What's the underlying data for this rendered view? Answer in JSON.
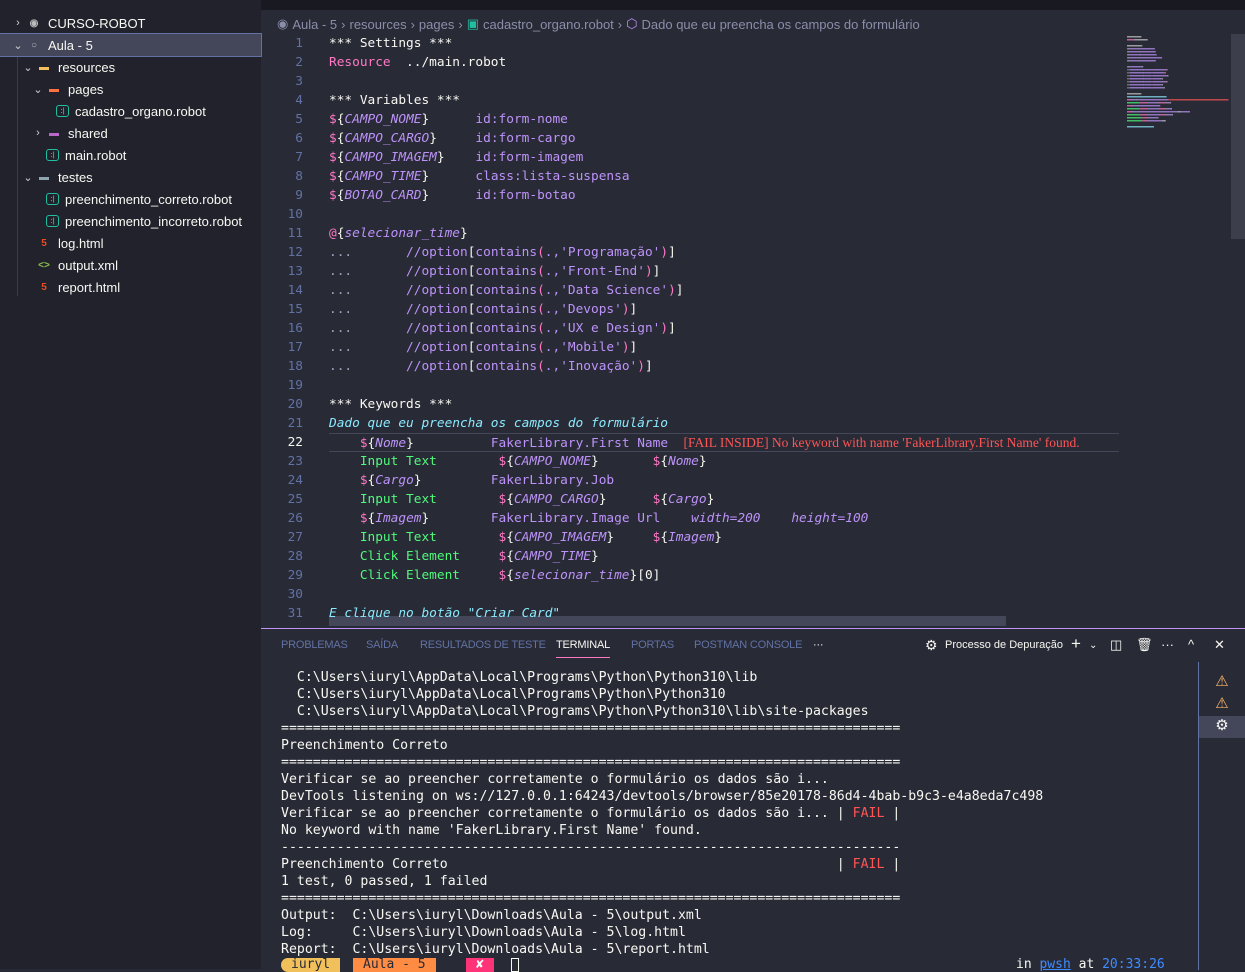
{
  "explorer": {
    "items": [
      {
        "label": "CURSO-ROBOT",
        "level": 0,
        "chev": "›",
        "icon": "circle-dot",
        "sel": false
      },
      {
        "label": "Aula - 5",
        "level": 0,
        "chev": "⌄",
        "icon": "circle",
        "sel": true
      },
      {
        "label": "resources",
        "level": 1,
        "chev": "⌄",
        "icon": "folder-resources",
        "sel": false
      },
      {
        "label": "pages",
        "level": 2,
        "chev": "⌄",
        "icon": "folder-pages",
        "sel": false
      },
      {
        "label": "cadastro_organo.robot",
        "level": 3,
        "chev": "",
        "icon": "robot",
        "sel": false
      },
      {
        "label": "shared",
        "level": 2,
        "chev": "›",
        "icon": "folder-shared",
        "sel": false
      },
      {
        "label": "main.robot",
        "level": 2,
        "chev": "",
        "icon": "robot",
        "sel": false
      },
      {
        "label": "testes",
        "level": 1,
        "chev": "⌄",
        "icon": "folder",
        "sel": false
      },
      {
        "label": "preenchimento_correto.robot",
        "level": 2,
        "chev": "",
        "icon": "robot",
        "sel": false
      },
      {
        "label": "preenchimento_incorreto.robot",
        "level": 2,
        "chev": "",
        "icon": "robot",
        "sel": false
      },
      {
        "label": "log.html",
        "level": 1,
        "chev": "",
        "icon": "html5",
        "sel": false
      },
      {
        "label": "output.xml",
        "level": 1,
        "chev": "",
        "icon": "xml",
        "sel": false
      },
      {
        "label": "report.html",
        "level": 1,
        "chev": "",
        "icon": "html5",
        "sel": false
      }
    ]
  },
  "breadcrumb": [
    "Aula - 5",
    "resources",
    "pages",
    "cadastro_organo.robot",
    "Dado que eu preencha os campos do formulário"
  ],
  "editor": {
    "current_line": 22,
    "lines": [
      [
        [
          "*** Settings ***",
          "k"
        ]
      ],
      [
        [
          "Resource",
          "p"
        ],
        [
          "  ../main.robot",
          "w"
        ]
      ],
      [],
      [
        [
          "*** Variables ***",
          "k"
        ]
      ],
      [
        [
          "$",
          "p"
        ],
        [
          "{",
          "w"
        ],
        [
          "CAMPO_NOME",
          "v"
        ],
        [
          "}",
          "w"
        ],
        [
          "      id:form-nome",
          "t"
        ]
      ],
      [
        [
          "$",
          "p"
        ],
        [
          "{",
          "w"
        ],
        [
          "CAMPO_CARGO",
          "v"
        ],
        [
          "}",
          "w"
        ],
        [
          "     id:form-cargo",
          "t"
        ]
      ],
      [
        [
          "$",
          "p"
        ],
        [
          "{",
          "w"
        ],
        [
          "CAMPO_IMAGEM",
          "v"
        ],
        [
          "}",
          "w"
        ],
        [
          "    id:form-imagem",
          "t"
        ]
      ],
      [
        [
          "$",
          "p"
        ],
        [
          "{",
          "w"
        ],
        [
          "CAMPO_TIME",
          "v"
        ],
        [
          "}",
          "w"
        ],
        [
          "      class:lista-suspensa",
          "t"
        ]
      ],
      [
        [
          "$",
          "p"
        ],
        [
          "{",
          "w"
        ],
        [
          "BOTAO_CARD",
          "v"
        ],
        [
          "}",
          "w"
        ],
        [
          "      id:form-botao",
          "t"
        ]
      ],
      [],
      [
        [
          "@",
          "p"
        ],
        [
          "{",
          "w"
        ],
        [
          "selecionar_time",
          "v"
        ],
        [
          "}",
          "w"
        ]
      ],
      [
        [
          "...",
          "d"
        ],
        [
          "       //option",
          "t"
        ],
        [
          "[",
          "w"
        ],
        [
          "contains",
          "t"
        ],
        [
          "(",
          "p"
        ],
        [
          ".,'Programação'",
          "t"
        ],
        [
          ")",
          "p"
        ],
        [
          "]",
          "w"
        ]
      ],
      [
        [
          "...",
          "d"
        ],
        [
          "       //option",
          "t"
        ],
        [
          "[",
          "w"
        ],
        [
          "contains",
          "t"
        ],
        [
          "(",
          "p"
        ],
        [
          ".,'Front-End'",
          "t"
        ],
        [
          ")",
          "p"
        ],
        [
          "]",
          "w"
        ]
      ],
      [
        [
          "...",
          "d"
        ],
        [
          "       //option",
          "t"
        ],
        [
          "[",
          "w"
        ],
        [
          "contains",
          "t"
        ],
        [
          "(",
          "p"
        ],
        [
          ".,'Data Science'",
          "t"
        ],
        [
          ")",
          "p"
        ],
        [
          "]",
          "w"
        ]
      ],
      [
        [
          "...",
          "d"
        ],
        [
          "       //option",
          "t"
        ],
        [
          "[",
          "w"
        ],
        [
          "contains",
          "t"
        ],
        [
          "(",
          "p"
        ],
        [
          ".,'Devops'",
          "t"
        ],
        [
          ")",
          "p"
        ],
        [
          "]",
          "w"
        ]
      ],
      [
        [
          "...",
          "d"
        ],
        [
          "       //option",
          "t"
        ],
        [
          "[",
          "w"
        ],
        [
          "contains",
          "t"
        ],
        [
          "(",
          "p"
        ],
        [
          ".,'UX e Design'",
          "t"
        ],
        [
          ")",
          "p"
        ],
        [
          "]",
          "w"
        ]
      ],
      [
        [
          "...",
          "d"
        ],
        [
          "       //option",
          "t"
        ],
        [
          "[",
          "w"
        ],
        [
          "contains",
          "t"
        ],
        [
          "(",
          "p"
        ],
        [
          ".,'Mobile'",
          "t"
        ],
        [
          ")",
          "p"
        ],
        [
          "]",
          "w"
        ]
      ],
      [
        [
          "...",
          "d"
        ],
        [
          "       //option",
          "t"
        ],
        [
          "[",
          "w"
        ],
        [
          "contains",
          "t"
        ],
        [
          "(",
          "p"
        ],
        [
          ".,'Inovação'",
          "t"
        ],
        [
          ")",
          "p"
        ],
        [
          "]",
          "w"
        ]
      ],
      [],
      [
        [
          "*** Keywords ***",
          "k"
        ]
      ],
      [
        [
          "Dado que eu preencha os campos do formulário",
          "c"
        ]
      ],
      [
        [
          "    $",
          "p"
        ],
        [
          "{",
          "w"
        ],
        [
          "Nome",
          "v"
        ],
        [
          "}",
          "w"
        ],
        [
          "          FakerLibrary.First Name  ",
          "t"
        ],
        [
          "[FAIL INSIDE] No keyword with name 'FakerLibrary.First Name' found.",
          "e"
        ]
      ],
      [
        [
          "    Input Text",
          "g"
        ],
        [
          "        $",
          "p"
        ],
        [
          "{",
          "w"
        ],
        [
          "CAMPO_NOME",
          "v"
        ],
        [
          "}",
          "w"
        ],
        [
          "       $",
          "p"
        ],
        [
          "{",
          "w"
        ],
        [
          "Nome",
          "v"
        ],
        [
          "}",
          "w"
        ]
      ],
      [
        [
          "    $",
          "p"
        ],
        [
          "{",
          "w"
        ],
        [
          "Cargo",
          "v"
        ],
        [
          "}",
          "w"
        ],
        [
          "         FakerLibrary.Job",
          "t"
        ]
      ],
      [
        [
          "    Input Text",
          "g"
        ],
        [
          "        $",
          "p"
        ],
        [
          "{",
          "w"
        ],
        [
          "CAMPO_CARGO",
          "v"
        ],
        [
          "}",
          "w"
        ],
        [
          "      $",
          "p"
        ],
        [
          "{",
          "w"
        ],
        [
          "Cargo",
          "v"
        ],
        [
          "}",
          "w"
        ]
      ],
      [
        [
          "    $",
          "p"
        ],
        [
          "{",
          "w"
        ],
        [
          "Imagem",
          "v"
        ],
        [
          "}",
          "w"
        ],
        [
          "        FakerLibrary.Image Url    ",
          "t"
        ],
        [
          "width=200",
          "v"
        ],
        [
          "    ",
          "w"
        ],
        [
          "height=100",
          "v"
        ]
      ],
      [
        [
          "    Input Text",
          "g"
        ],
        [
          "        $",
          "p"
        ],
        [
          "{",
          "w"
        ],
        [
          "CAMPO_IMAGEM",
          "v"
        ],
        [
          "}",
          "w"
        ],
        [
          "     $",
          "p"
        ],
        [
          "{",
          "w"
        ],
        [
          "Imagem",
          "v"
        ],
        [
          "}",
          "w"
        ]
      ],
      [
        [
          "    Click Element",
          "g"
        ],
        [
          "     $",
          "p"
        ],
        [
          "{",
          "w"
        ],
        [
          "CAMPO_TIME",
          "v"
        ],
        [
          "}",
          "w"
        ]
      ],
      [
        [
          "    Click Element",
          "g"
        ],
        [
          "     $",
          "p"
        ],
        [
          "{",
          "w"
        ],
        [
          "selecionar_time",
          "v"
        ],
        [
          "}",
          "w"
        ],
        [
          "[0]",
          "w"
        ]
      ],
      [],
      [
        [
          "E clique no botão \"Criar Card\"",
          "c"
        ]
      ]
    ]
  },
  "panel": {
    "tabs": [
      "PROBLEMAS",
      "SAÍDA",
      "RESULTADOS DE TESTE",
      "TERMINAL",
      "PORTAS",
      "POSTMAN CONSOLE"
    ],
    "active_tab": "TERMINAL",
    "more": "···",
    "debug_label": "Processo de Depuração",
    "terminal": {
      "lines": [
        {
          "text": "  C:\\Users\\iuryl\\AppData\\Local\\Programs\\Python\\Python310\\lib"
        },
        {
          "text": "  C:\\Users\\iuryl\\AppData\\Local\\Programs\\Python\\Python310"
        },
        {
          "text": "  C:\\Users\\iuryl\\AppData\\Local\\Programs\\Python\\Python310\\lib\\site-packages"
        },
        {
          "text": "=============================================================================="
        },
        {
          "text": "Preenchimento Correto"
        },
        {
          "text": "=============================================================================="
        },
        {
          "text": "Verificar se ao preencher corretamente o formulário os dados são i..."
        },
        {
          "text": "DevTools listening on ws://127.0.0.1:64243/devtools/browser/85e20178-86d4-4bab-b9c3-e4a8eda7c498"
        },
        {
          "text": "Verificar se ao preencher corretamente o formulário os dados são i... | ",
          "status": "FAIL",
          "tail": " |"
        },
        {
          "text": "No keyword with name 'FakerLibrary.First Name' found."
        },
        {
          "text": "------------------------------------------------------------------------------"
        },
        {
          "text": "Preenchimento Correto                                                 | ",
          "status": "FAIL",
          "tail": " |"
        },
        {
          "text": "1 test, 0 passed, 1 failed"
        },
        {
          "text": "=============================================================================="
        },
        {
          "text": "Output:  C:\\Users\\iuryl\\Downloads\\Aula - 5\\output.xml"
        },
        {
          "text": "Log:     C:\\Users\\iuryl\\Downloads\\Aula - 5\\log.html"
        },
        {
          "text": "Report:  C:\\Users\\iuryl\\Downloads\\Aula - 5\\report.html"
        }
      ],
      "prompt": {
        "user": "iuryl",
        "dir": " Aula - 5",
        "status": "✘",
        "right_in": "in ",
        "right_shell": "pwsh",
        "right_at": " at ",
        "right_time": "20:33:26"
      }
    }
  },
  "colors": {
    "background": "#282a36",
    "sidebar": "#21222c",
    "accent": "#bd93f9",
    "pink": "#ff79c6",
    "green": "#50fa7b",
    "cyan": "#8be9fd",
    "error": "#ff5555"
  }
}
